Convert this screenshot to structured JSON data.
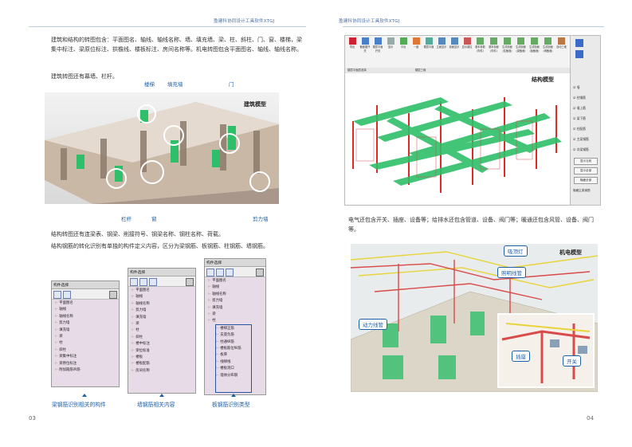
{
  "header": {
    "left": "盈建科协同设计工具软件XTGJ",
    "right": "盈建科协同设计工具软件XTGJ"
  },
  "page_left": {
    "page_number": "03",
    "para1": "建筑和结构的转图包含：平面图名、轴线、轴线名称、墙、填充墙、梁、柱、斜柱、门、窗、楼梯，梁集中标注、梁原位标注、拱檐线、楼板标注、房间名称等。机电转图包含平面图名、轴线、轴线名称。",
    "para2": "建筑转图还有幕墙、栏杆。",
    "arch_model": {
      "title": "建筑模型",
      "callouts": {
        "stair": "楼梯",
        "infill": "填充墙",
        "door": "门",
        "rail": "栏杆",
        "window": "窗",
        "shear": "剪力墙"
      }
    },
    "para3": "结构转图还有连梁表、钢梁、削接符号、钢梁名称、钢柱名称、荷载。",
    "para4": "结构钢筋的转化识别有单独的构件定义内容，区分为梁钢筋、板钢筋、柱钢筋、墙钢筋。",
    "panel1": {
      "title": "构件选择",
      "items": [
        "平面图名",
        "轴线",
        "轴线名称",
        "剪力墙",
        "填充墙",
        "梁",
        "柱",
        "斜柱",
        "梁集中标注",
        "梁原位标注",
        "附加箍筋吊筋"
      ]
    },
    "panel2": {
      "title": "构件选择",
      "items": [
        "平面图名",
        "轴线",
        "轴线名称",
        "剪力墙",
        "填充墙",
        "梁",
        "柱",
        "斜柱",
        "楼中标注",
        "梁位标准",
        "楼板",
        "楼板配筋",
        "房间名称"
      ]
    },
    "panel3": {
      "title": "构件选择",
      "items": [
        "平面图名",
        "轴线",
        "轴线名称",
        "剪力墙",
        "填充墙",
        "梁",
        "柱"
      ],
      "rebar_items": [
        "楼梯正筋",
        "支座负筋",
        "柱通纵筋",
        "楼板筋位纵筋",
        "板厚",
        "线梯线",
        "楼板洞口",
        "墙体分布钢"
      ]
    },
    "captions": {
      "c1": "梁钢筋识别相关的构件",
      "c2": "墙钢筋相关内容",
      "c3": "板钢筋识别类型"
    }
  },
  "page_right": {
    "page_number": "04",
    "struct_model": {
      "title": "结构模型",
      "toolbar_buttons": [
        "导出",
        "截面图开关",
        "楼层平面开关",
        "显示",
        "平台",
        "一键",
        "楼层平面",
        "立面显示",
        "剖面显示",
        "显示梁柱",
        "基本参数(构件)",
        "基本剖面(构件)",
        "生成剖面(柱截面)",
        "生成剖面(梁截面)",
        "生成剖面(板截面)",
        "生成剖面(墙截面)",
        "自动三维"
      ],
      "side_checks": [
        "墙",
        "柱钢筋",
        "墙上筋",
        "梁下筋",
        "柱配筋",
        "主梁钢筋",
        "次梁钢筋"
      ],
      "side_buttons": [
        "显示当前",
        "显示全部",
        "隐藏全部"
      ],
      "bottom_label": "隐藏主梁钢筋",
      "tab_label": "楼层平面层选择",
      "tab_center": "楼层三维"
    },
    "para1": "电气还包含开关、插座、设备等；给排水还包含管道、设备、阀门等；暖通还包含风管、设备、阀门等。",
    "mep_model": {
      "title": "机电模型",
      "callouts": {
        "ceiling_light": "吸顶灯",
        "lighting_pipe": "照明线管",
        "power_pipe": "动力线管",
        "socket": "插座",
        "switch": "开关"
      }
    }
  },
  "colors": {
    "accent": "#1d5fa8",
    "wall_green": "#2fbf6a",
    "rebar_red": "#e02a2a"
  }
}
